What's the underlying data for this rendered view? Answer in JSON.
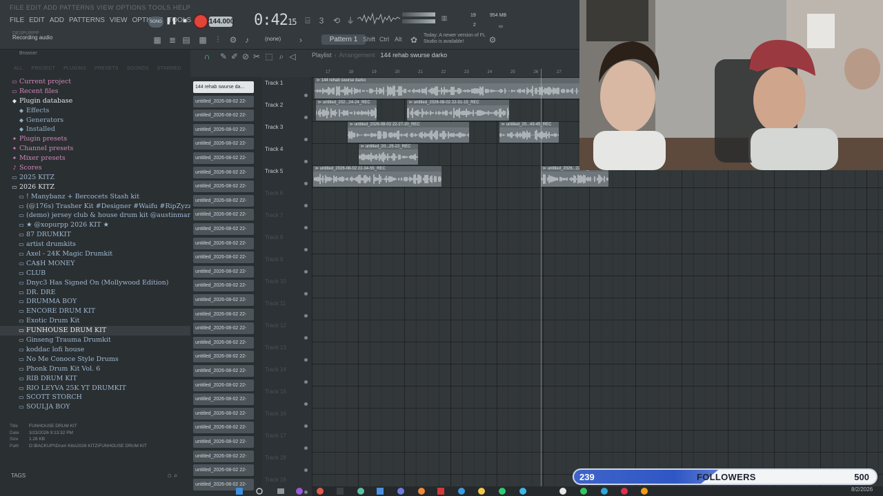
{
  "menu": [
    "FILE",
    "EDIT",
    "ADD",
    "PATTERNS",
    "VIEW",
    "OPTIONS",
    "TOOLS",
    "HELP"
  ],
  "ghost_menu": "FILE EDIT ADD PATTERNS VIEW OPTIONS TOOLS HELP",
  "song_badge": "SONG",
  "tempo": "144.000",
  "time_main": "0:42",
  "time_sub": "15",
  "cpu": {
    "top": "19",
    "bottom": "2"
  },
  "mem": "954 MB",
  "hint": {
    "faint": "DESPURPP",
    "main": "Recording audio"
  },
  "pattern_label": "Pattern 1",
  "none_select": "(none)",
  "keys": [
    "Shift",
    "Ctrl",
    "Alt"
  ],
  "news": "Today: A newer version of FL Studio is available!",
  "browser": {
    "header": "Browser",
    "tabs": [
      "ALL",
      "PROJECT",
      "PLUGINS",
      "PRESETS",
      "SOUNDS",
      "STARRED"
    ],
    "items": [
      {
        "label": "Current project",
        "style": "pink",
        "icon": "folder",
        "indent": 0
      },
      {
        "label": "Recent files",
        "style": "pink",
        "icon": "folder",
        "indent": 0
      },
      {
        "label": "Plugin database",
        "style": "white",
        "icon": "plug",
        "indent": 0
      },
      {
        "label": "Effects",
        "style": "lightblue",
        "icon": "plug",
        "indent": 1
      },
      {
        "label": "Generators",
        "style": "lightblue",
        "icon": "plug",
        "indent": 1
      },
      {
        "label": "Installed",
        "style": "lightblue",
        "icon": "plug",
        "indent": 1
      },
      {
        "label": "Plugin presets",
        "style": "pink",
        "icon": "star",
        "indent": 0
      },
      {
        "label": "Channel presets",
        "style": "pink",
        "icon": "star",
        "indent": 0
      },
      {
        "label": "Mixer presets",
        "style": "pink",
        "icon": "star",
        "indent": 0
      },
      {
        "label": "Scores",
        "style": "pink",
        "icon": "note",
        "indent": 0
      },
      {
        "label": "2025 KITZ",
        "style": "blue",
        "icon": "folder",
        "indent": 0
      },
      {
        "label": "2026 KITZ",
        "style": "white",
        "icon": "folder-open",
        "indent": 0
      },
      {
        "label": "! Manybanz + Bercocets Stash kit",
        "style": "blue",
        "icon": "folder",
        "indent": 1
      },
      {
        "label": "(@176s) Trasher Kit #Designer #Waifu #RipZyzz",
        "style": "blue",
        "icon": "folder",
        "indent": 1
      },
      {
        "label": "(demo) jersey club & house drum kit @austinmarc",
        "style": "blue",
        "icon": "folder",
        "indent": 1
      },
      {
        "label": "★ @xopurpp 2026 KIT ★",
        "style": "blue",
        "icon": "folder",
        "indent": 1
      },
      {
        "label": "87 DRUMKIT",
        "style": "blue",
        "icon": "folder",
        "indent": 1
      },
      {
        "label": "artist drumkits",
        "style": "blue",
        "icon": "folder",
        "indent": 1
      },
      {
        "label": "Axel - 24K Magic Drumkit",
        "style": "blue",
        "icon": "folder",
        "indent": 1
      },
      {
        "label": "CA$H MONEY",
        "style": "blue",
        "icon": "folder",
        "indent": 1
      },
      {
        "label": "CLUB",
        "style": "blue",
        "icon": "folder",
        "indent": 1
      },
      {
        "label": "Dnyc3 Has Signed On (Mollywood Edition)",
        "style": "blue",
        "icon": "folder",
        "indent": 1
      },
      {
        "label": "DR. DRE",
        "style": "blue",
        "icon": "folder",
        "indent": 1
      },
      {
        "label": "DRUMMA BOY",
        "style": "blue",
        "icon": "folder",
        "indent": 1
      },
      {
        "label": "ENCORE DRUM KIT",
        "style": "blue",
        "icon": "folder",
        "indent": 1
      },
      {
        "label": "Exotic Drum Kit",
        "style": "blue",
        "icon": "folder",
        "indent": 1
      },
      {
        "label": "FUNHOUSE DRUM KIT",
        "style": "highlight",
        "icon": "folder",
        "indent": 1
      },
      {
        "label": "Ginseng Trauma Drumkit",
        "style": "blue",
        "icon": "folder",
        "indent": 1
      },
      {
        "label": "koddac lofi house",
        "style": "blue",
        "icon": "folder",
        "indent": 1
      },
      {
        "label": "No Me Conoce Style Drums",
        "style": "blue",
        "icon": "folder",
        "indent": 1
      },
      {
        "label": "Phonk Drum Kit Vol. 6",
        "style": "blue",
        "icon": "folder",
        "indent": 1
      },
      {
        "label": "RIB DRUM KIT",
        "style": "blue",
        "icon": "folder",
        "indent": 1
      },
      {
        "label": "RIO LEYVA 25K YT DRUMKIT",
        "style": "blue",
        "icon": "folder",
        "indent": 1
      },
      {
        "label": "SCOTT STORCH",
        "style": "blue",
        "icon": "folder",
        "indent": 1
      },
      {
        "label": "SOULJA BOY",
        "style": "blue",
        "icon": "folder",
        "indent": 1
      }
    ],
    "file_info": {
      "title_key": "Title",
      "title": "FUNHOUSE DRUM KIT",
      "date_key": "Date",
      "date": "3/23/2026 9:13:32 PM",
      "size_key": "Size",
      "size": "1.28 KB",
      "path_key": "Path",
      "path": "D:\\BACKUP!\\Drum Kits\\2026 KITZ\\FUNHOUSE DRUM KIT"
    },
    "tags_label": "TAGS"
  },
  "playlist": {
    "title": "Playlist",
    "arrangement": "Arrangement",
    "song": "144 rehab swurse darko",
    "ruler": [
      "17",
      "18",
      "19",
      "20",
      "21",
      "22",
      "23",
      "24",
      "25",
      "26",
      "27"
    ],
    "patterns": [
      "144 rehab swurse da...",
      "untitled_2026-08-02 22-",
      "untitled_2026-08-02 22-",
      "untitled_2026-08-02 22-",
      "untitled_2026-08-02 22-",
      "untitled_2026-08-02 22-",
      "untitled_2026-08-02 22-",
      "untitled_2026-08-02 22-",
      "untitled_2026-08-02 22-",
      "untitled_2026-08-02 22-",
      "untitled_2026-08-02 22-",
      "untitled_2026-08-02 22-",
      "untitled_2026-08-02 22-",
      "untitled_2026-08-02 22-",
      "untitled_2026-08-02 22-",
      "untitled_2026-08-02 22-",
      "untitled_2026-08-02 22-",
      "untitled_2026-08-02 22-",
      "untitled_2026-08-02 22-",
      "untitled_2026-08-02 22-",
      "untitled_2026-08-02 22-",
      "untitled_2026-08-02 22-",
      "untitled_2026-08-02 22-",
      "untitled_2026-08-02 22-",
      "untitled_2026-08-02 22-",
      "untitled_2026-08-02 22-",
      "untitled_2026-08-02 22-",
      "untitled_2026-08-02 22-",
      "untitled_2026-08-02 22-"
    ],
    "tracks": [
      "Track 1",
      "Track 2",
      "Track 3",
      "Track 4",
      "Track 5",
      "Track 6",
      "Track 7",
      "Track 8",
      "Track 9",
      "Track 10",
      "Track 11",
      "Track 12",
      "Track 13",
      "Track 14",
      "Track 15",
      "Track 16",
      "Track 17",
      "Track 18",
      "Track 19"
    ],
    "clips": [
      {
        "label": "144 rehab swurse darko",
        "track": 1
      },
      {
        "label": "untitled_202...24-24_REC",
        "track": 2
      },
      {
        "label": "untitled_2026-08-02 22-31-15_REC",
        "track": 2
      },
      {
        "label": "untitled_2026-08-02 22-27-20_REC",
        "track": 3
      },
      {
        "label": "untitled_20...43-45_REC",
        "track": 3
      },
      {
        "label": "untitled_20...25-22_REC",
        "track": 4
      },
      {
        "label": "untitled_2026-08-02 22-34-55_REC",
        "track": 5
      },
      {
        "label": "untitled_2026...22-34_REC",
        "track": 5
      }
    ]
  },
  "followers": {
    "current": "239",
    "label": "FOLLOWERS",
    "goal": "500",
    "progress": 0.478
  },
  "date": "8/2/2026"
}
